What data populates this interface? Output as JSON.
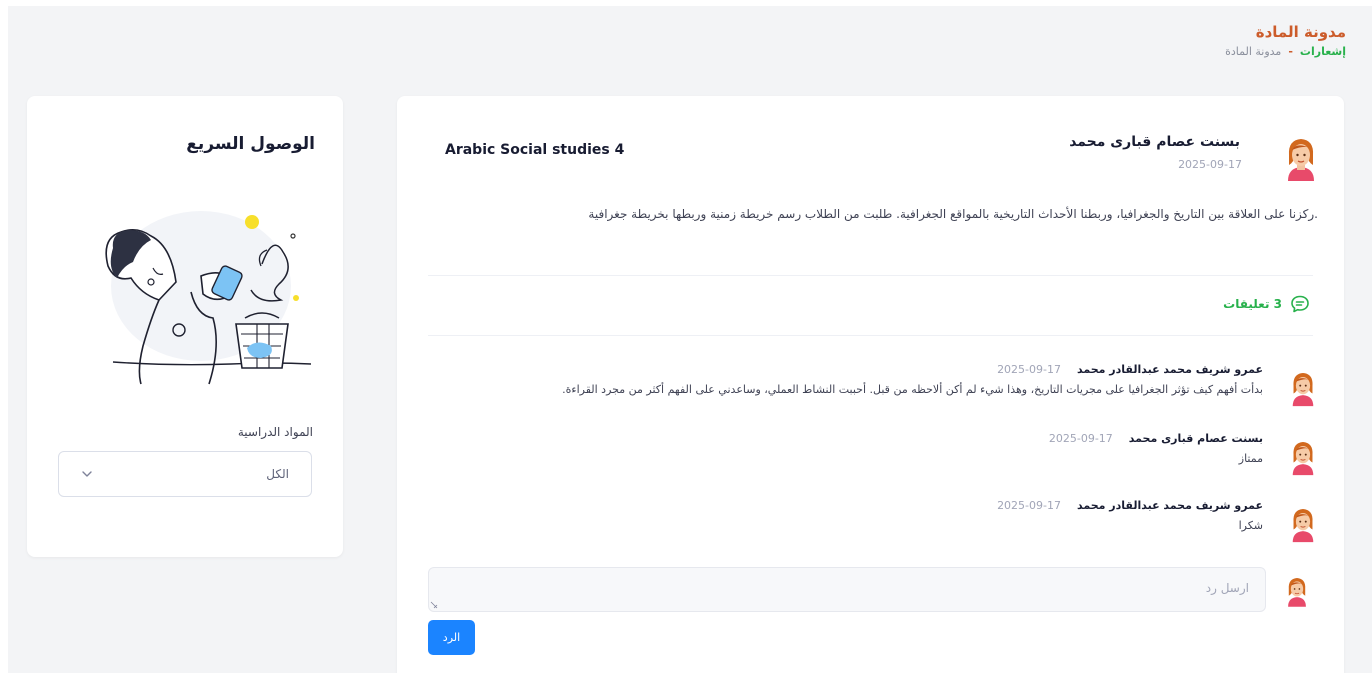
{
  "header": {
    "title": "مدونة المادة",
    "breadcrumb": {
      "active": "إشعارات",
      "separator": "-",
      "current": "مدونة المادة"
    }
  },
  "post": {
    "author": "بسنت عصام قبارى محمد",
    "date": "2025-09-17",
    "subject": "Arabic Social studies 4",
    "text": ".ركزنا على العلاقة بين التاريخ والجغرافيا، وربطنا الأحداث التاريخية بالمواقع الجغرافية. طلبت من الطلاب رسم خريطة زمنية وربطها بخريطة جغرافية",
    "comments_label": "3 تعليقات",
    "comments": [
      {
        "author": "عمرو شريف محمد عبدالقادر محمد",
        "date": "2025-09-17",
        "text": "بدأت أفهم كيف تؤثر الجغرافيا على مجريات التاريخ، وهذا شيء لم أكن ألاحظه من قبل. أحببت النشاط العملي، وساعدني على الفهم أكثر من مجرد القراءة."
      },
      {
        "author": "بسنت عصام قبارى محمد",
        "date": "2025-09-17",
        "text": "ممتاز"
      },
      {
        "author": "عمرو شريف محمد عبدالقادر محمد",
        "date": "2025-09-17",
        "text": "شكرا"
      }
    ],
    "reply_placeholder": "ارسل رد",
    "reply_button": "الرد"
  },
  "quick_access": {
    "title": "الوصول السريع",
    "subjects_label": "المواد الدراسية",
    "subjects_selected": "الكل"
  },
  "colors": {
    "accent": "#cc5c2b",
    "green": "#28b14c",
    "primary": "#1b84ff"
  }
}
